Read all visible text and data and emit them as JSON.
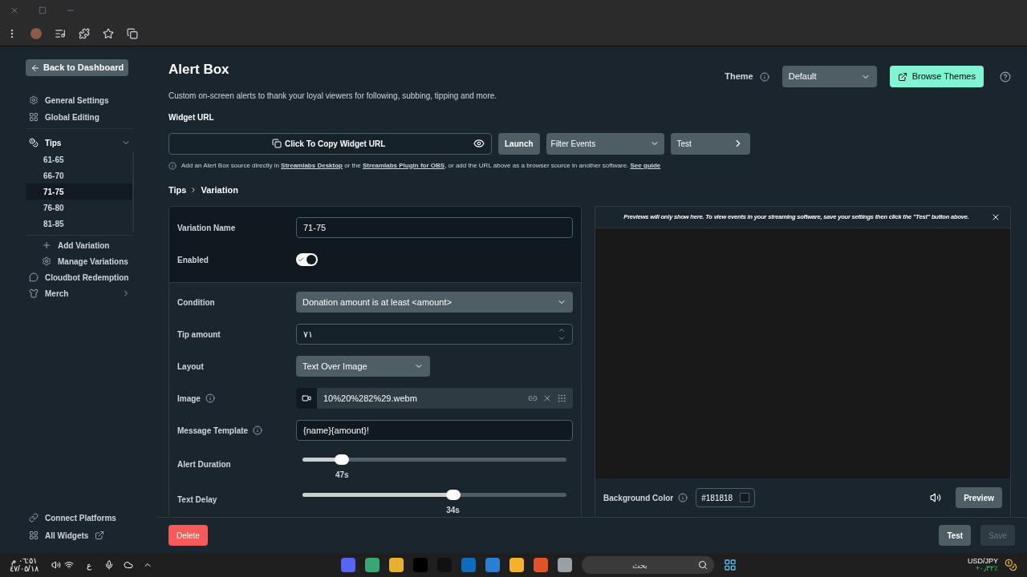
{
  "sidebar": {
    "back_button": "Back to Dashboard",
    "items": [
      {
        "label": "General Settings"
      },
      {
        "label": "Global Editing"
      }
    ],
    "tips": {
      "label": "Tips",
      "expanded": true,
      "variations": [
        {
          "label": "61-65",
          "selected": false
        },
        {
          "label": "66-70",
          "selected": false
        },
        {
          "label": "71-75",
          "selected": true
        },
        {
          "label": "76-80",
          "selected": false
        },
        {
          "label": "81-85",
          "selected": false
        }
      ],
      "actions": [
        {
          "label": "Add Variation"
        },
        {
          "label": "Manage Variations"
        }
      ]
    },
    "more": [
      {
        "label": "Cloudbot Redemption"
      },
      {
        "label": "Merch"
      }
    ],
    "footer": [
      {
        "label": "Connect Platforms",
        "external": false
      },
      {
        "label": "All Widgets",
        "external": true
      }
    ]
  },
  "header": {
    "title": "Alert Box",
    "subtitle": "Custom on-screen alerts to thank your loyal viewers for following, subbing, tipping and more.",
    "theme_label": "Theme",
    "theme_value": "Default",
    "browse_button": "Browse Themes"
  },
  "widget_url": {
    "label": "Widget URL",
    "copy_text": "Click To Copy Widget URL",
    "launch": "Launch",
    "filter": "Filter Events",
    "test": "Test",
    "note_parts": [
      {
        "kind": "text",
        "text": "Add an Alert Box source directly in "
      },
      {
        "kind": "link",
        "text": "Streamlabs Desktop"
      },
      {
        "kind": "text",
        "text": " or the "
      },
      {
        "kind": "link",
        "text": "Streamlabs Plugin for OBS"
      },
      {
        "kind": "text",
        "text": ", or add the URL above as a browser source in another software. "
      },
      {
        "kind": "link",
        "text": "See guide"
      }
    ]
  },
  "breadcrumb": [
    "Tips",
    "Variation"
  ],
  "form": {
    "top": [
      {
        "kind": "text",
        "label": "Variation Name",
        "value": "71-75"
      },
      {
        "kind": "toggle",
        "label": "Enabled",
        "on": true
      }
    ],
    "rows": [
      {
        "kind": "select",
        "label": "Condition",
        "value": "Donation amount is at least <amount>"
      },
      {
        "kind": "number",
        "label": "Tip amount",
        "value": "٧١"
      },
      {
        "kind": "select_small",
        "label": "Layout",
        "value": "Text Over Image"
      },
      {
        "kind": "file",
        "label": "Image",
        "info": true,
        "value": "10%20%282%29.webm"
      },
      {
        "kind": "text",
        "label": "Message Template",
        "info": true,
        "value": "{name}{amount}!"
      },
      {
        "kind": "slider",
        "label": "Alert Duration",
        "level": 0.15,
        "reading": "47s"
      },
      {
        "kind": "slider",
        "label": "Text Delay",
        "level": 0.57,
        "reading": "34s"
      }
    ]
  },
  "preview": {
    "notice": "Previews will only show here. To view events in your streaming software, save your settings then click the \"Test\" button above.",
    "bg_label": "Background Color",
    "bg_value": "#181818",
    "preview_button": "Preview"
  },
  "footer_bar": {
    "delete": "Delete",
    "test": "Test",
    "save": "Save"
  },
  "taskbar": {
    "time": "٠٦:٥١ م",
    "date": "٤٧/٠٥/١٨",
    "lang": "ع",
    "search": "بحث",
    "ticker": "USD/JPY",
    "change": "+٠٫٣٢٪"
  }
}
